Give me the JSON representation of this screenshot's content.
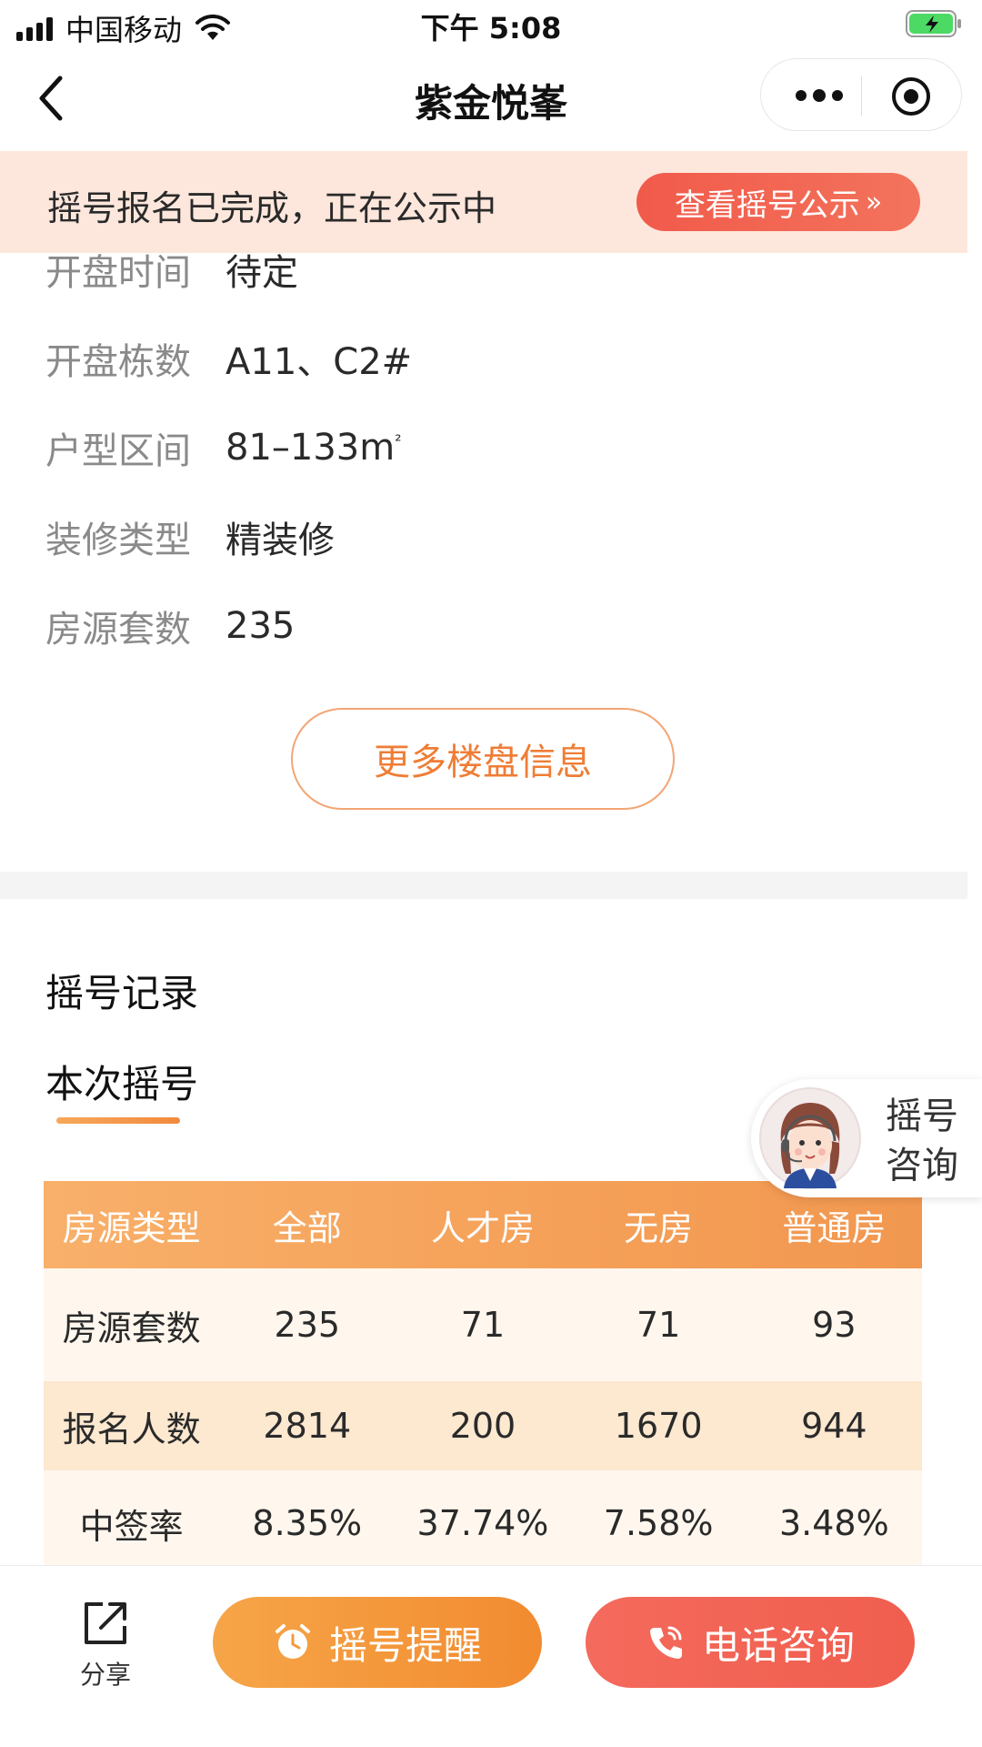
{
  "status_bar": {
    "carrier": "中国移动",
    "time": "下午 5:08"
  },
  "nav": {
    "title": "紫金悦峯"
  },
  "notice": {
    "text": "摇号报名已完成，正在公示中",
    "button_label": "查看摇号公示",
    "button_chevron": "»"
  },
  "info": [
    {
      "label": "开盘时间",
      "value": "待定"
    },
    {
      "label": "开盘栋数",
      "value": "A11、C2#"
    },
    {
      "label": "户型区间",
      "value": "81–133m",
      "sup": "²"
    },
    {
      "label": "装修类型",
      "value": "精装修"
    },
    {
      "label": "房源套数",
      "value": "235"
    }
  ],
  "more_button": "更多楼盘信息",
  "record": {
    "section_title": "摇号记录",
    "tab_current": "本次摇号"
  },
  "consult": {
    "line1": "摇号",
    "line2": "咨询"
  },
  "table": {
    "headers": [
      "房源类型",
      "全部",
      "人才房",
      "无房",
      "普通房"
    ],
    "rows": [
      [
        "房源套数",
        "235",
        "71",
        "71",
        "93"
      ],
      [
        "报名人数",
        "2814",
        "200",
        "1670",
        "944"
      ],
      [
        "中签率",
        "8.35%",
        "37.74%",
        "7.58%",
        "3.48%"
      ]
    ]
  },
  "bottom": {
    "share_label": "分享",
    "remind_label": "摇号提醒",
    "call_label": "电话咨询"
  },
  "colors": {
    "accent_orange": "#f28b30",
    "accent_red": "#f05e4e",
    "notice_bg": "#fde7dc"
  }
}
